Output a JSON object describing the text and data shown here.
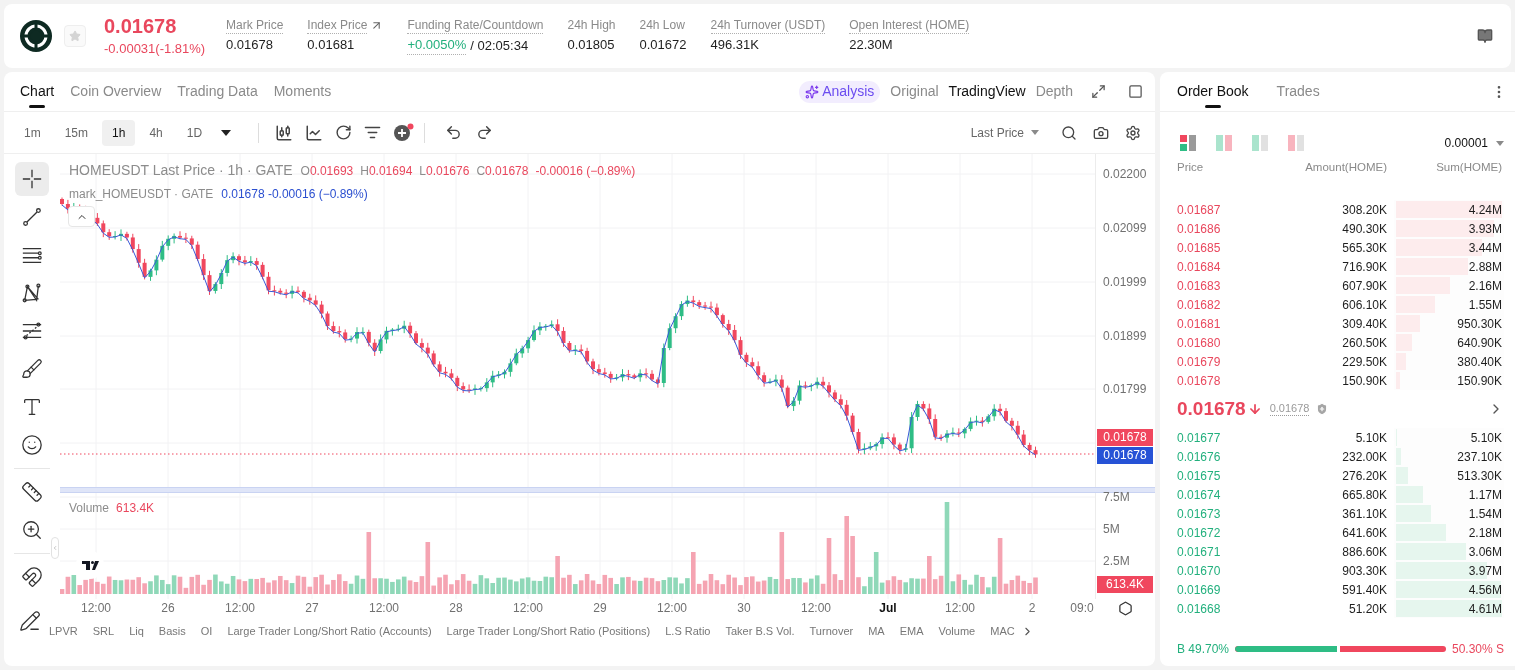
{
  "header": {
    "price": "0.01678",
    "change": "-0.00031(-1.81%)",
    "stats": [
      {
        "label": "Mark Price",
        "value": "0.01678",
        "kind": "plain",
        "tooltip": true
      },
      {
        "label": "Index Price",
        "value": "0.01681",
        "kind": "link",
        "tooltip": true
      },
      {
        "label": "Funding Rate/Countdown",
        "value": "+0.0050%",
        "countdown": "/ 02:05:34",
        "kind": "funding",
        "tooltip": true
      },
      {
        "label": "24h High",
        "value": "0.01805",
        "kind": "plain",
        "tooltip": false
      },
      {
        "label": "24h Low",
        "value": "0.01672",
        "kind": "plain",
        "tooltip": false
      },
      {
        "label": "24h Turnover (USDT)",
        "value": "496.31K",
        "kind": "plain",
        "tooltip": true
      },
      {
        "label": "Open Interest (HOME)",
        "value": "22.30M",
        "kind": "plain",
        "tooltip": true
      }
    ]
  },
  "chart_panel": {
    "tabs": [
      {
        "label": "Chart",
        "selected": true
      },
      {
        "label": "Coin Overview",
        "selected": false
      },
      {
        "label": "Trading Data",
        "selected": false
      },
      {
        "label": "Moments",
        "selected": false
      }
    ],
    "views": [
      {
        "label": "Analysis",
        "kind": "ai",
        "selected": false
      },
      {
        "label": "Original",
        "kind": "text",
        "selected": false
      },
      {
        "label": "TradingView",
        "kind": "text",
        "selected": true
      },
      {
        "label": "Depth",
        "kind": "text",
        "selected": false
      }
    ],
    "intervals": [
      {
        "label": "1m",
        "selected": false
      },
      {
        "label": "15m",
        "selected": false
      },
      {
        "label": "1h",
        "selected": true
      },
      {
        "label": "4h",
        "selected": false
      },
      {
        "label": "1D",
        "selected": false
      }
    ],
    "price_source": "Last Price",
    "tool_groups": [
      {
        "tools": [
          {
            "kind": "crosshair",
            "selected": true
          },
          {
            "kind": "trend-line",
            "selected": false
          },
          {
            "kind": "parallel-lines",
            "selected": false
          },
          {
            "kind": "pattern",
            "selected": false
          },
          {
            "kind": "fib",
            "selected": false
          },
          {
            "kind": "brush",
            "selected": false
          },
          {
            "kind": "text",
            "selected": false
          },
          {
            "kind": "emoji",
            "selected": false
          }
        ]
      },
      {
        "tools": [
          {
            "kind": "ruler",
            "selected": false
          },
          {
            "kind": "zoom",
            "selected": false
          }
        ]
      },
      {
        "tools": [
          {
            "kind": "magnet",
            "selected": false
          }
        ]
      },
      {
        "tools": [
          {
            "kind": "lock-drawing",
            "selected": false
          }
        ]
      }
    ],
    "legend": {
      "title": "HOMEUSDT Last Price · 1h · GATE",
      "ohlc": [
        {
          "key": "O",
          "value": "0.01693"
        },
        {
          "key": "H",
          "value": "0.01694"
        },
        {
          "key": "L",
          "value": "0.01676"
        },
        {
          "key": "C",
          "value": "0.01678"
        }
      ],
      "change": "-0.00016 (−0.89%)",
      "mark_title": "mark_HOMEUSDT · GATE",
      "mark_values": "0.01678 -0.00016 (−0.89%)"
    },
    "price_axis": {
      "ticks": [
        "0.02200",
        "0.02099",
        "0.01999",
        "0.01899",
        "0.01799"
      ],
      "last_price_tag": "0.01678",
      "mark_price_tag": "0.01678"
    },
    "volume": {
      "label": "Volume",
      "value": "613.4K",
      "ticks": [
        "7.5M",
        "5M",
        "2.5M"
      ],
      "tag": "613.4K"
    },
    "time_axis": [
      {
        "label": "12:00",
        "kind": "time"
      },
      {
        "label": "26",
        "kind": "day"
      },
      {
        "label": "12:00",
        "kind": "time"
      },
      {
        "label": "27",
        "kind": "day"
      },
      {
        "label": "12:00",
        "kind": "time"
      },
      {
        "label": "28",
        "kind": "day"
      },
      {
        "label": "12:00",
        "kind": "time"
      },
      {
        "label": "29",
        "kind": "day"
      },
      {
        "label": "12:00",
        "kind": "time"
      },
      {
        "label": "30",
        "kind": "day"
      },
      {
        "label": "12:00",
        "kind": "time"
      },
      {
        "label": "Jul",
        "kind": "month"
      },
      {
        "label": "12:00",
        "kind": "time"
      },
      {
        "label": "2",
        "kind": "day"
      },
      {
        "label": "09:0",
        "kind": "time"
      }
    ],
    "indicators": [
      "LPVR",
      "SRL",
      "Liq",
      "Basis",
      "OI",
      "Large Trader Long/Short Ratio (Accounts)",
      "Large Trader Long/Short Ratio (Positions)",
      "L.S Ratio",
      "Taker B.S Vol.",
      "Turnover",
      "MA",
      "EMA",
      "Volume",
      "MAC"
    ]
  },
  "order_book": {
    "tabs": [
      {
        "label": "Order Book",
        "selected": true
      },
      {
        "label": "Trades",
        "selected": false
      }
    ],
    "layouts": [
      {
        "kind": "both",
        "selected": true
      },
      {
        "kind": "split",
        "selected": false
      },
      {
        "kind": "bids",
        "selected": false
      },
      {
        "kind": "asks",
        "selected": false
      }
    ],
    "precision": "0.00001",
    "columns": [
      "Price",
      "Amount(HOME)",
      "Sum(HOME)"
    ],
    "asks": [
      {
        "price": "0.01687",
        "amount": "308.20K",
        "sum": "4.24M",
        "level": 1.0
      },
      {
        "price": "0.01686",
        "amount": "490.30K",
        "sum": "3.93M",
        "level": 0.927
      },
      {
        "price": "0.01685",
        "amount": "565.30K",
        "sum": "3.44M",
        "level": 0.811
      },
      {
        "price": "0.01684",
        "amount": "716.90K",
        "sum": "2.88M",
        "level": 0.679
      },
      {
        "price": "0.01683",
        "amount": "607.90K",
        "sum": "2.16M",
        "level": 0.509
      },
      {
        "price": "0.01682",
        "amount": "606.10K",
        "sum": "1.55M",
        "level": 0.366
      },
      {
        "price": "0.01681",
        "amount": "309.40K",
        "sum": "950.30K",
        "level": 0.224
      },
      {
        "price": "0.01680",
        "amount": "260.50K",
        "sum": "640.90K",
        "level": 0.151
      },
      {
        "price": "0.01679",
        "amount": "229.50K",
        "sum": "380.40K",
        "level": 0.09
      },
      {
        "price": "0.01678",
        "amount": "150.90K",
        "sum": "150.90K",
        "level": 0.036
      }
    ],
    "last": {
      "price": "0.01678",
      "falling": true,
      "mark": "0.01678"
    },
    "bids": [
      {
        "price": "0.01677",
        "amount": "5.10K",
        "sum": "5.10K",
        "level": 0.001
      },
      {
        "price": "0.01676",
        "amount": "232.00K",
        "sum": "237.10K",
        "level": 0.051
      },
      {
        "price": "0.01675",
        "amount": "276.20K",
        "sum": "513.30K",
        "level": 0.111
      },
      {
        "price": "0.01674",
        "amount": "665.80K",
        "sum": "1.17M",
        "level": 0.254
      },
      {
        "price": "0.01673",
        "amount": "361.10K",
        "sum": "1.54M",
        "level": 0.334
      },
      {
        "price": "0.01672",
        "amount": "641.60K",
        "sum": "2.18M",
        "level": 0.473
      },
      {
        "price": "0.01671",
        "amount": "886.60K",
        "sum": "3.06M",
        "level": 0.664
      },
      {
        "price": "0.01670",
        "amount": "903.30K",
        "sum": "3.97M",
        "level": 0.861
      },
      {
        "price": "0.01669",
        "amount": "591.40K",
        "sum": "4.56M",
        "level": 0.989
      },
      {
        "price": "0.01668",
        "amount": "51.20K",
        "sum": "4.61M",
        "level": 1.0
      }
    ],
    "ratio": {
      "buy": "B 49.70%",
      "sell": "50.30% S",
      "level": 0.497
    }
  }
}
